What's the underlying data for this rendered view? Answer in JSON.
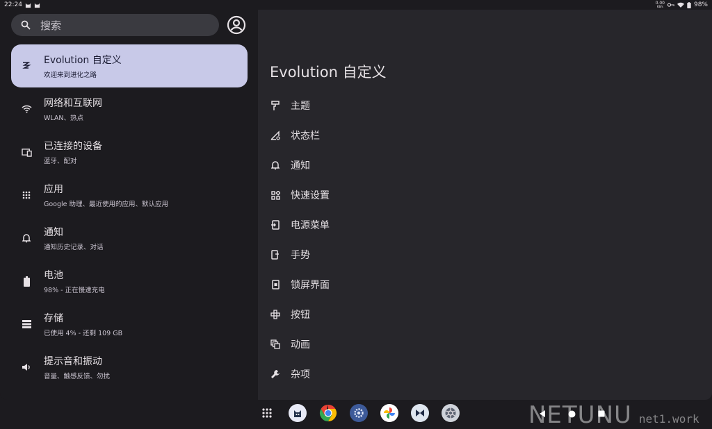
{
  "status_bar": {
    "time": "22:24",
    "net_speed_top": "0.00",
    "net_speed_bottom": "KB/s",
    "battery": "98%",
    "left_icons": [
      "cat-app-icon",
      "cat-app-icon"
    ],
    "right_icons": [
      "vpn-key-icon",
      "wifi-icon",
      "battery-icon"
    ]
  },
  "search": {
    "placeholder": "搜索",
    "icon": "search-icon"
  },
  "account_icon": "account-circle-icon",
  "sidebar": {
    "items": [
      {
        "title": "Evolution 自定义",
        "subtitle": "欢迎来到进化之路",
        "icon": "evolution-icon",
        "selected": true
      },
      {
        "title": "网络和互联网",
        "subtitle": "WLAN、热点",
        "icon": "wifi-icon"
      },
      {
        "title": "已连接的设备",
        "subtitle": "蓝牙、配对",
        "icon": "devices-icon"
      },
      {
        "title": "应用",
        "subtitle": "Google 助理、最近使用的应用、默认应用",
        "icon": "apps-grid-icon"
      },
      {
        "title": "通知",
        "subtitle": "通知历史记录、对话",
        "icon": "bell-icon"
      },
      {
        "title": "电池",
        "subtitle": "98% - 正在慢速充电",
        "icon": "battery-icon"
      },
      {
        "title": "存储",
        "subtitle": "已使用 4% - 还剩 109 GB",
        "icon": "storage-icon"
      },
      {
        "title": "提示音和振动",
        "subtitle": "音量、触感反馈、勿扰",
        "icon": "volume-icon"
      }
    ]
  },
  "detail": {
    "title": "Evolution 自定义",
    "options": [
      {
        "label": "主题",
        "icon": "paint-roller-icon"
      },
      {
        "label": "状态栏",
        "icon": "signal-settings-icon"
      },
      {
        "label": "通知",
        "icon": "bell-icon"
      },
      {
        "label": "快速设置",
        "icon": "tiles-icon"
      },
      {
        "label": "电源菜单",
        "icon": "power-menu-icon"
      },
      {
        "label": "手势",
        "icon": "gesture-phone-icon"
      },
      {
        "label": "锁屏界面",
        "icon": "lockscreen-icon"
      },
      {
        "label": "按钮",
        "icon": "dpad-icon"
      },
      {
        "label": "动画",
        "icon": "animation-icon"
      },
      {
        "label": "杂项",
        "icon": "wrench-icon"
      }
    ]
  },
  "taskbar": {
    "apps": [
      "all-apps-icon",
      "cat-app-icon",
      "chrome-icon",
      "settings-icon",
      "photos-icon",
      "evolution-app-icon",
      "aperture-icon"
    ],
    "nav": [
      "back-icon",
      "home-icon",
      "recents-icon"
    ]
  },
  "watermark": {
    "brand": "NETUNU",
    "site": "net1.work"
  }
}
